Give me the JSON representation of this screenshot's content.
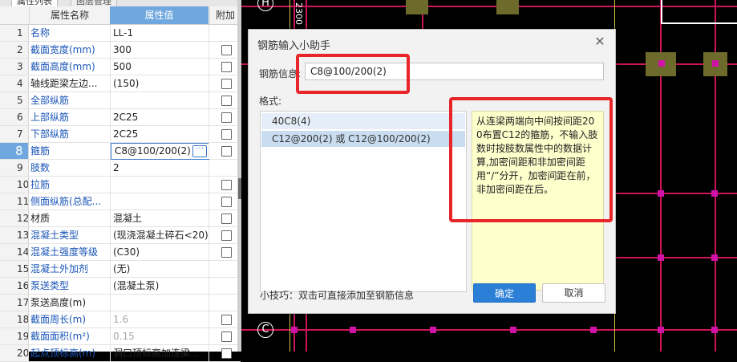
{
  "panel": {
    "tabs": [
      "属性列表",
      "图层管理"
    ],
    "header": {
      "name": "属性名称",
      "value": "属性值",
      "extra": "附加"
    },
    "rows": [
      {
        "num": "1",
        "name": "名称",
        "value": "LL-1",
        "link": true,
        "checkbox": false
      },
      {
        "num": "2",
        "name": "截面宽度(mm)",
        "value": "300",
        "link": true,
        "checkbox": true
      },
      {
        "num": "3",
        "name": "截面高度(mm)",
        "value": "500",
        "link": true,
        "checkbox": true
      },
      {
        "num": "4",
        "name": "轴线距梁左边...",
        "value": "(150)",
        "link": false,
        "checkbox": true
      },
      {
        "num": "5",
        "name": "全部纵筋",
        "value": "",
        "link": true,
        "checkbox": true
      },
      {
        "num": "6",
        "name": "上部纵筋",
        "value": "2C25",
        "link": true,
        "checkbox": true
      },
      {
        "num": "7",
        "name": "下部纵筋",
        "value": "2C25",
        "link": true,
        "checkbox": true
      },
      {
        "num": "8",
        "name": "箍筋",
        "value": "C8@100/200(2)",
        "link": true,
        "checkbox": true,
        "selected": true
      },
      {
        "num": "9",
        "name": "肢数",
        "value": "2",
        "link": true,
        "checkbox": false
      },
      {
        "num": "10",
        "name": "拉筋",
        "value": "",
        "link": true,
        "checkbox": true
      },
      {
        "num": "11",
        "name": "侧面纵筋(总配...",
        "value": "",
        "link": true,
        "checkbox": true
      },
      {
        "num": "12",
        "name": "材质",
        "value": "混凝土",
        "link": false,
        "checkbox": true
      },
      {
        "num": "13",
        "name": "混凝土类型",
        "value": "(现浇混凝土碎石<20)",
        "link": true,
        "checkbox": true
      },
      {
        "num": "14",
        "name": "混凝土强度等级",
        "value": "(C30)",
        "link": true,
        "checkbox": true
      },
      {
        "num": "15",
        "name": "混凝土外加剂",
        "value": "(无)",
        "link": true,
        "checkbox": false
      },
      {
        "num": "16",
        "name": "泵送类型",
        "value": "(混凝土泵)",
        "link": true,
        "checkbox": false
      },
      {
        "num": "17",
        "name": "泵送高度(m)",
        "value": "",
        "link": false,
        "checkbox": false
      },
      {
        "num": "18",
        "name": "截面周长(m)",
        "value": "1.6",
        "link": true,
        "checkbox": true,
        "gray": true
      },
      {
        "num": "19",
        "name": "截面面积(m²)",
        "value": "0.15",
        "link": true,
        "checkbox": true,
        "gray": true
      },
      {
        "num": "20",
        "name": "起点顶标高(m)",
        "value": "洞口顶标高加连梁...",
        "link": true,
        "checkbox": true
      }
    ],
    "more_icon": "ellipsis-icon"
  },
  "cad": {
    "axis_label_top": "H",
    "axis_label_top_dim": "2300",
    "axis_label_bottom": "C",
    "line_color": "#d0145a",
    "node_color": "#d012a8"
  },
  "dialog": {
    "title": "钢筋输入小助手",
    "close_icon": "close-icon",
    "rebar_label": "钢筋信息:",
    "rebar_value": "C8@100/200(2)",
    "format_label": "格式:",
    "formats": [
      "40C8(4)",
      "C12@200(2) 或 C12@100/200(2)"
    ],
    "description": "从连梁两端向中间按间距200布置C12的箍筋，不输入肢数时按肢数属性中的数据计算,加密间距和非加密间距用“/”分开，加密间距在前，非加密间距在后。",
    "tip": "小技巧：双击可直接添加至钢筋信息",
    "ok_label": "确定",
    "cancel_label": "取消",
    "accent": "#2b7fd6",
    "highlight_color": "#e8262a"
  }
}
